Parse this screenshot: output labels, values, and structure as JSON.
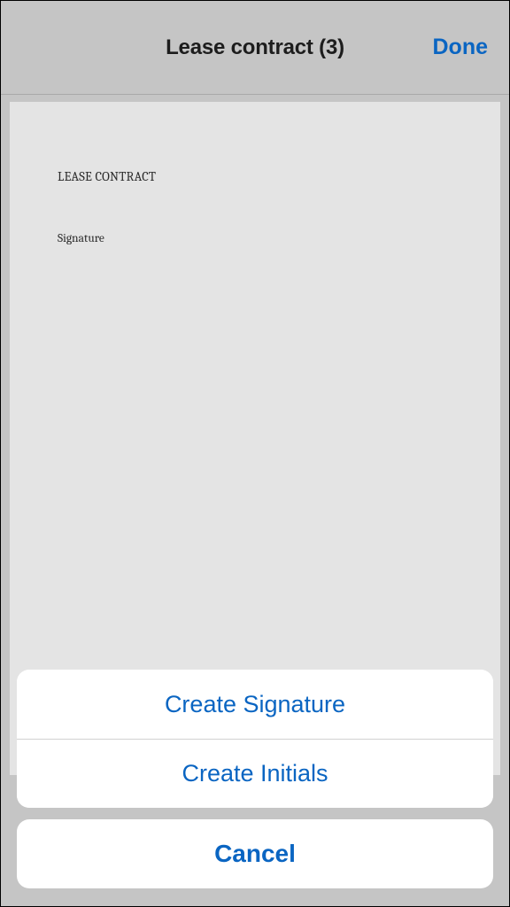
{
  "header": {
    "title": "Lease contract (3)",
    "done_label": "Done"
  },
  "document": {
    "heading": "LEASE CONTRACT",
    "signature_label": "Signature"
  },
  "action_sheet": {
    "create_signature_label": "Create Signature",
    "create_initials_label": "Create Initials",
    "cancel_label": "Cancel"
  }
}
